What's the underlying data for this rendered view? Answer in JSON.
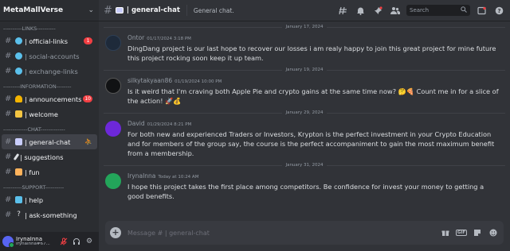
{
  "server": {
    "name": "MetaMallVerse"
  },
  "categories": {
    "links": "----------LINKS----------",
    "information": "---------INFORMATION--------",
    "chat": "-------------CHAT-------------",
    "support": "----------SUPPORT----------"
  },
  "channels": {
    "links": [
      {
        "label": "| official-links",
        "badge": "1",
        "emoji_color": "#5bc0eb"
      },
      {
        "label": "| social-accounts",
        "badge": "",
        "emoji_color": "#5bc0eb"
      },
      {
        "label": "| exchange-links",
        "badge": "",
        "emoji_color": "#5bc0eb"
      }
    ],
    "information": [
      {
        "label": "| announcements",
        "badge": "10",
        "emoji_color": "#f4b400"
      },
      {
        "label": "| welcome",
        "badge": "",
        "emoji_color": "#f4c542"
      }
    ],
    "chat": [
      {
        "label": "| general-chat",
        "badge": "",
        "emoji_color": "#c9cdfb"
      },
      {
        "label": "| suggestions",
        "badge": "",
        "emoji_color": "#dbdee1"
      },
      {
        "label": "| fun",
        "badge": "",
        "emoji_color": "#ffb35c"
      }
    ],
    "support": [
      {
        "label": "| help",
        "badge": "",
        "emoji_color": "#5bc0eb"
      },
      {
        "label": "| ask-something",
        "badge": "",
        "emoji_color": "#dbdee1"
      }
    ]
  },
  "user": {
    "name": "IrynaInna",
    "tag": "IrynaInna#67..."
  },
  "topbar": {
    "channel": "| general-chat",
    "topic": "General chat.",
    "search_placeholder": "Search"
  },
  "messages": [
    {
      "divider": "January 17, 2024",
      "author": "Ontor",
      "timestamp": "01/17/2024 3:18 PM",
      "avatar_color": "#1e2a3a",
      "text": "DingDang project is our last hope to recover our losses i am realy happy to join this great project for mine future this project rocking soon keep it up team."
    },
    {
      "divider": "January 19, 2024",
      "author": "silkytakyaan86",
      "timestamp": "01/19/2024 10:00 PM",
      "avatar_color": "#111214",
      "text": "Is it weird that I'm craving both Apple Pie and crypto gains at the same time now? 🤔🍕 Count me in for a slice of the action! 🚀💰"
    },
    {
      "divider": "January 29, 2024",
      "author": "David",
      "timestamp": "01/29/2024 8:21 PM",
      "avatar_color": "#6d28d9",
      "text": "For both new and experienced Traders or Investors, Krypton is the perfect investment in your Crypto Education and for members of the group say, the course is the perfect accompaniment to gain the most maximum benefit from a membership."
    },
    {
      "divider": "January 31, 2024",
      "author": "IrynaInna",
      "timestamp": "Today at 10:24 AM",
      "avatar_color": "#23a55a",
      "text": "I hope this project takes the first place among competitors. Be confidence for invest your money to getting a good benefits."
    }
  ],
  "composer": {
    "placeholder": "Message #   | general-chat"
  }
}
